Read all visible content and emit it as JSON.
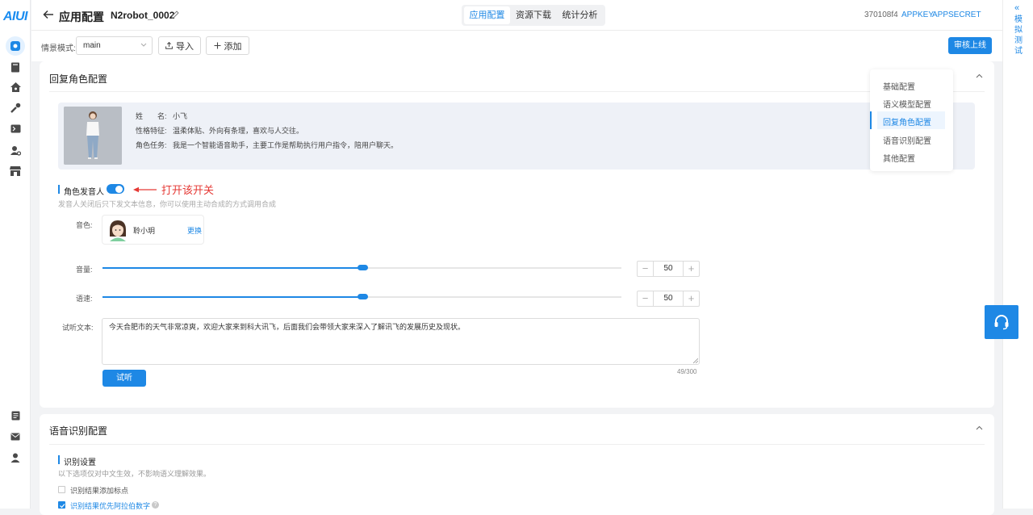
{
  "app": {
    "logo": "AIUI"
  },
  "header": {
    "back_icon": "arrow-left-icon",
    "title": "应用配置",
    "robot_name": "N2robot_0002",
    "tabs": [
      {
        "label": "应用配置",
        "active": true
      },
      {
        "label": "资源下载",
        "active": false
      },
      {
        "label": "统计分析",
        "active": false
      }
    ],
    "app_id": "370108f4",
    "appkey_label": "APPKEY",
    "appsecret_label": "APPSECRET"
  },
  "filter": {
    "scene_label": "情景模式:",
    "scene_value": "main",
    "import_label": "导入",
    "add_label": "添加",
    "publish_label": "审核上线"
  },
  "right_panel": {
    "collapse_glyph": "«",
    "label_chars": [
      "模",
      "拟",
      "测",
      "试"
    ]
  },
  "role_section": {
    "title": "回复角色配置",
    "profile": {
      "name_label": "姓　　名:",
      "name_value": "小飞",
      "trait_label": "性格特征:",
      "trait_value": "温柔体贴、外向有条理，喜欢与人交往。",
      "task_label": "角色任务:",
      "task_value": "我是一个智能语音助手，主要工作是帮助执行用户指令，陪用户聊天。"
    },
    "speaker_label": "角色发音人",
    "speaker_enabled": true,
    "annotation": "打开该开关",
    "hint": "发音人关闭后只下发文本信息，你可以使用主动合成的方式调用合成",
    "voice_label": "音色:",
    "voice_name": "聆小玥",
    "voice_change": "更换",
    "volume_label": "音量:",
    "volume_value": "50",
    "speed_label": "语速:",
    "speed_value": "50",
    "preview_label": "试听文本:",
    "preview_text": "今天合肥市的天气非常凉爽，欢迎大家来到科大讯飞，后面我们会带领大家来深入了解讯飞的发展历史及现状。",
    "char_count": "49/300",
    "listen_button": "试听"
  },
  "toc": {
    "items": [
      {
        "label": "基础配置",
        "active": false
      },
      {
        "label": "语义模型配置",
        "active": false
      },
      {
        "label": "回复角色配置",
        "active": true
      },
      {
        "label": "语音识别配置",
        "active": false
      },
      {
        "label": "其他配置",
        "active": false
      }
    ]
  },
  "asr_section": {
    "title": "语音识别配置",
    "sub_title": "识别设置",
    "hint": "以下选项仅对中文生效，不影响语义理解效果。",
    "options": [
      {
        "label": "识别结果添加标点",
        "checked": false
      },
      {
        "label": "识别结果优先阿拉伯数字",
        "checked": true
      }
    ]
  },
  "colors": {
    "accent": "#1e88e5",
    "annotation": "#e53935",
    "bg": "#f2f3f5",
    "profile_bg": "#eef1f7"
  },
  "sidebar_icons": [
    "robot-icon",
    "book-icon",
    "app-icon",
    "tools-icon",
    "terminal-icon",
    "user-settings-icon",
    "store-icon",
    "document-icon",
    "mail-icon",
    "account-icon"
  ],
  "floating": {
    "icon": "headset-support-icon"
  }
}
